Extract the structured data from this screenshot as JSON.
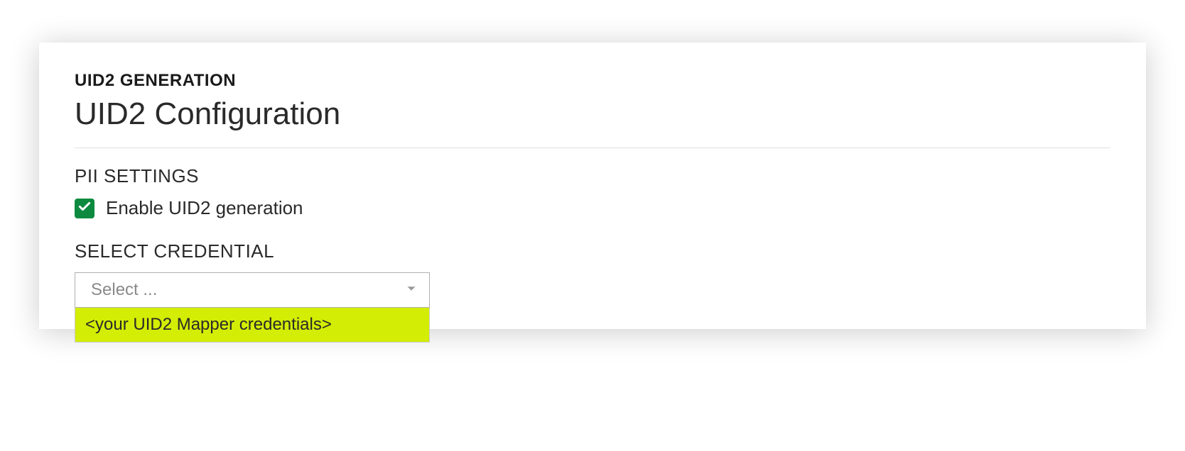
{
  "header": {
    "overline": "UID2 GENERATION",
    "title": "UID2 Configuration"
  },
  "pii": {
    "section_label": "PII SETTINGS",
    "enable_label": "Enable UID2 generation",
    "enabled": true
  },
  "credential": {
    "section_label": "SELECT CREDENTIAL",
    "placeholder": "Select ...",
    "options": [
      {
        "label": "<your UID2 Mapper credentials>",
        "highlighted": true
      }
    ]
  },
  "colors": {
    "checkbox_green": "#0d8a3f",
    "dropdown_highlight": "#d4ed04"
  }
}
